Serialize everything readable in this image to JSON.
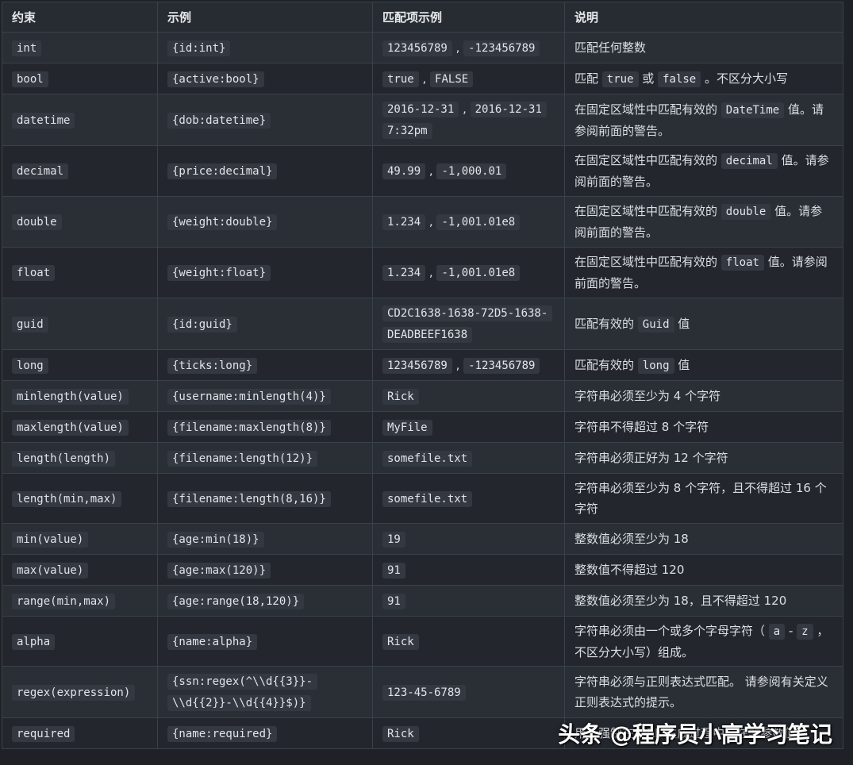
{
  "header": {
    "constraint": "约束",
    "example": "示例",
    "match_example": "匹配项示例",
    "description": "说明"
  },
  "rows": [
    {
      "constraint": "int",
      "example": "{id:int}",
      "matches": [
        "123456789",
        "-123456789"
      ],
      "description": [
        {
          "t": "匹配任何整数"
        }
      ]
    },
    {
      "constraint": "bool",
      "example": "{active:bool}",
      "matches": [
        "true",
        "FALSE"
      ],
      "description": [
        {
          "t": "匹配 "
        },
        {
          "c": "true"
        },
        {
          "t": " 或 "
        },
        {
          "c": "false"
        },
        {
          "t": " 。不区分大小写"
        }
      ]
    },
    {
      "constraint": "datetime",
      "example": "{dob:datetime}",
      "matches": [
        "2016-12-31",
        "2016-12-31 7:32pm"
      ],
      "description": [
        {
          "t": "在固定区域性中匹配有效的 "
        },
        {
          "c": "DateTime"
        },
        {
          "t": " 值。请参阅前面的警告。"
        }
      ]
    },
    {
      "constraint": "decimal",
      "example": "{price:decimal}",
      "matches": [
        "49.99",
        "-1,000.01"
      ],
      "description": [
        {
          "t": "在固定区域性中匹配有效的 "
        },
        {
          "c": "decimal"
        },
        {
          "t": " 值。请参阅前面的警告。"
        }
      ]
    },
    {
      "constraint": "double",
      "example": "{weight:double}",
      "matches": [
        "1.234",
        "-1,001.01e8"
      ],
      "description": [
        {
          "t": "在固定区域性中匹配有效的 "
        },
        {
          "c": "double"
        },
        {
          "t": " 值。请参阅前面的警告。"
        }
      ]
    },
    {
      "constraint": "float",
      "example": "{weight:float}",
      "matches": [
        "1.234",
        "-1,001.01e8"
      ],
      "description": [
        {
          "t": "在固定区域性中匹配有效的 "
        },
        {
          "c": "float"
        },
        {
          "t": " 值。请参阅前面的警告。"
        }
      ]
    },
    {
      "constraint": "guid",
      "example": "{id:guid}",
      "matches": [
        "CD2C1638-1638-72D5-1638-DEADBEEF1638"
      ],
      "description": [
        {
          "t": "匹配有效的 "
        },
        {
          "c": "Guid"
        },
        {
          "t": " 值"
        }
      ]
    },
    {
      "constraint": "long",
      "example": "{ticks:long}",
      "matches": [
        "123456789",
        "-123456789"
      ],
      "description": [
        {
          "t": "匹配有效的 "
        },
        {
          "c": "long"
        },
        {
          "t": " 值"
        }
      ]
    },
    {
      "constraint": "minlength(value)",
      "example": "{username:minlength(4)}",
      "matches": [
        "Rick"
      ],
      "description": [
        {
          "t": "字符串必须至少为 4 个字符"
        }
      ]
    },
    {
      "constraint": "maxlength(value)",
      "example": "{filename:maxlength(8)}",
      "matches": [
        "MyFile"
      ],
      "description": [
        {
          "t": "字符串不得超过 8 个字符"
        }
      ]
    },
    {
      "constraint": "length(length)",
      "example": "{filename:length(12)}",
      "matches": [
        "somefile.txt"
      ],
      "description": [
        {
          "t": "字符串必须正好为 12 个字符"
        }
      ]
    },
    {
      "constraint": "length(min,max)",
      "example": "{filename:length(8,16)}",
      "matches": [
        "somefile.txt"
      ],
      "description": [
        {
          "t": "字符串必须至少为 8 个字符，且不得超过 16 个字符"
        }
      ]
    },
    {
      "constraint": "min(value)",
      "example": "{age:min(18)}",
      "matches": [
        "19"
      ],
      "description": [
        {
          "t": "整数值必须至少为 18"
        }
      ]
    },
    {
      "constraint": "max(value)",
      "example": "{age:max(120)}",
      "matches": [
        "91"
      ],
      "description": [
        {
          "t": "整数值不得超过 120"
        }
      ]
    },
    {
      "constraint": "range(min,max)",
      "example": "{age:range(18,120)}",
      "matches": [
        "91"
      ],
      "description": [
        {
          "t": "整数值必须至少为 18，且不得超过 120"
        }
      ]
    },
    {
      "constraint": "alpha",
      "example": "{name:alpha}",
      "matches": [
        "Rick"
      ],
      "description": [
        {
          "t": "字符串必须由一个或多个字母字符（ "
        },
        {
          "c": "a"
        },
        {
          "t": " - "
        },
        {
          "c": "z"
        },
        {
          "t": " ，不区分大小写）组成。"
        }
      ]
    },
    {
      "constraint": "regex(expression)",
      "example": "{ssn:regex(^\\\\d{{3}}-\\\\d{{2}}-\\\\d{{4}}$)}",
      "matches": [
        "123-45-6789"
      ],
      "description": [
        {
          "t": "字符串必须与正则表达式匹配。 请参阅有关定义正则表达式的提示。"
        }
      ]
    },
    {
      "constraint": "required",
      "example": "{name:required}",
      "matches": [
        "Rick"
      ],
      "description": [
        {
          "t": "用于强制在 URL 生成过程中存在非参数值"
        }
      ]
    }
  ],
  "watermark": "头条 @程序员小高学习笔记"
}
